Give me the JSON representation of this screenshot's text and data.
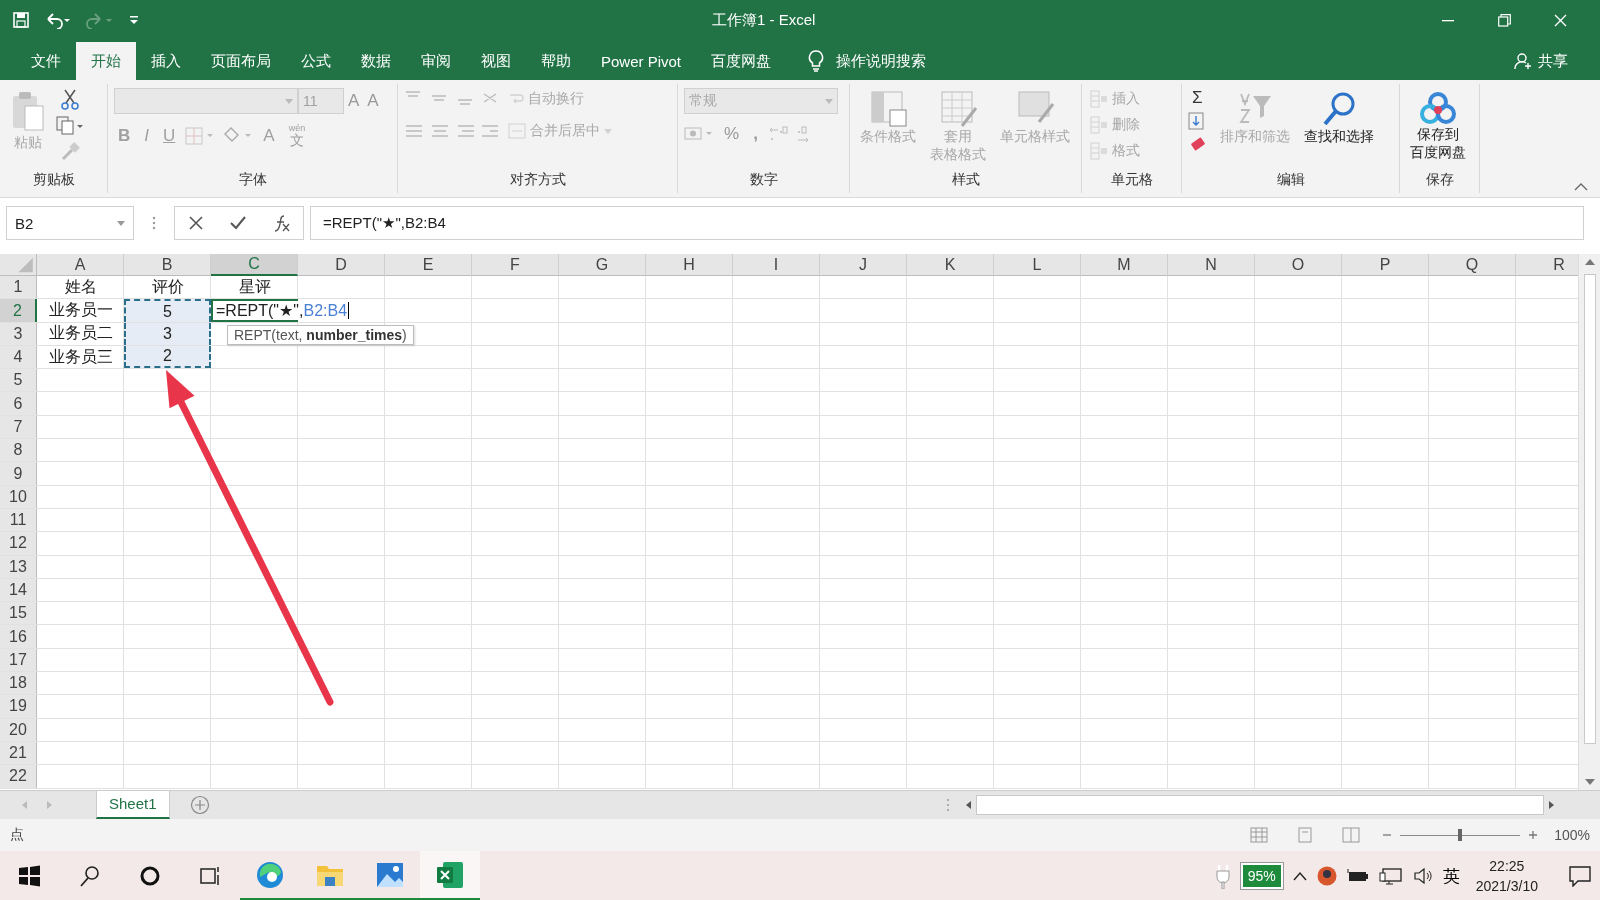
{
  "title_bar": {
    "title": "工作簿1  -  Excel"
  },
  "ribbon_tabs": [
    {
      "label": "文件",
      "selected": false
    },
    {
      "label": "开始",
      "selected": true
    },
    {
      "label": "插入",
      "selected": false
    },
    {
      "label": "页面布局",
      "selected": false
    },
    {
      "label": "公式",
      "selected": false
    },
    {
      "label": "数据",
      "selected": false
    },
    {
      "label": "审阅",
      "selected": false
    },
    {
      "label": "视图",
      "selected": false
    },
    {
      "label": "帮助",
      "selected": false
    },
    {
      "label": "Power Pivot",
      "selected": false
    },
    {
      "label": "百度网盘",
      "selected": false
    }
  ],
  "tell_me": "操作说明搜索",
  "share": "共享",
  "ribbon": {
    "clipboard": {
      "label": "剪贴板",
      "paste": {
        "label": "粘贴",
        "disabled": true
      }
    },
    "font": {
      "label": "字体",
      "font_size": "11",
      "grow": "A",
      "shrink": "A",
      "bold": "B",
      "italic": "I",
      "underline": "U",
      "font_color": "A",
      "phonetic_hint": "wén",
      "phonetic": "文",
      "disabled": true
    },
    "alignment": {
      "label": "对齐方式",
      "wrap": "自动换行",
      "merge": "合并后居中",
      "disabled": true
    },
    "number": {
      "label": "数字",
      "format": "常规",
      "percent": "%",
      "comma": ",",
      "disabled": true
    },
    "styles": {
      "label": "样式",
      "buttons": [
        {
          "label": "条件格式",
          "disabled": true
        },
        {
          "label": "套用",
          "label2": "表格格式",
          "disabled": true
        },
        {
          "label": "单元格样式",
          "disabled": true
        }
      ]
    },
    "cells": {
      "label": "单元格",
      "buttons": [
        {
          "label": "插入",
          "disabled": true
        },
        {
          "label": "删除",
          "disabled": true
        },
        {
          "label": "格式",
          "disabled": true
        }
      ]
    },
    "editing": {
      "label": "编辑",
      "sum": "Σ",
      "sort": {
        "label": "排序和筛选",
        "disabled": true
      },
      "find": {
        "label": "查找和选择",
        "disabled": false
      }
    },
    "save": {
      "label": "保存",
      "button": {
        "label": "保存到",
        "label2": "百度网盘",
        "disabled": false
      }
    }
  },
  "formula_bar": {
    "name_box": "B2",
    "formula": "=REPT(\"★\",B2:B4"
  },
  "columns": [
    {
      "label": "A",
      "selected": false
    },
    {
      "label": "B",
      "selected": false
    },
    {
      "label": "C",
      "selected": true
    },
    {
      "label": "D",
      "selected": false
    },
    {
      "label": "E",
      "selected": false
    },
    {
      "label": "F",
      "selected": false
    },
    {
      "label": "G",
      "selected": false
    },
    {
      "label": "H",
      "selected": false
    },
    {
      "label": "I",
      "selected": false
    },
    {
      "label": "J",
      "selected": false
    },
    {
      "label": "K",
      "selected": false
    },
    {
      "label": "L",
      "selected": false
    },
    {
      "label": "M",
      "selected": false
    },
    {
      "label": "N",
      "selected": false
    },
    {
      "label": "O",
      "selected": false
    },
    {
      "label": "P",
      "selected": false
    },
    {
      "label": "Q",
      "selected": false
    },
    {
      "label": "R",
      "selected": false
    }
  ],
  "rows": [
    {
      "header": "1",
      "selected": false,
      "cells": [
        {
          "text": "姓名",
          "highlighted": false
        },
        {
          "text": "评价",
          "highlighted": false
        },
        {
          "text": "星评",
          "highlighted": false
        }
      ]
    },
    {
      "header": "2",
      "selected": true,
      "cells": [
        {
          "text": "业务员一",
          "highlighted": false
        },
        {
          "text": "5",
          "highlighted": true
        },
        {
          "editing": {
            "text": "=REPT(\"★\",",
            "reference": "B2:B4"
          },
          "tooltip": "REPT(text, **number_times**)",
          "highlighted": false
        }
      ]
    },
    {
      "header": "3",
      "selected": false,
      "cells": [
        {
          "text": "业务员二",
          "highlighted": false
        },
        {
          "text": "3",
          "highlighted": true
        }
      ]
    },
    {
      "header": "4",
      "selected": false,
      "cells": [
        {
          "text": "业务员三",
          "highlighted": false
        },
        {
          "text": "2",
          "highlighted": true
        }
      ]
    },
    {
      "header": "5",
      "selected": false
    },
    {
      "header": "6",
      "selected": false
    },
    {
      "header": "7",
      "selected": false
    },
    {
      "header": "8",
      "selected": false
    },
    {
      "header": "9",
      "selected": false
    },
    {
      "header": "10",
      "selected": false
    },
    {
      "header": "11",
      "selected": false
    },
    {
      "header": "12",
      "selected": false
    },
    {
      "header": "13",
      "selected": false
    },
    {
      "header": "14",
      "selected": false
    },
    {
      "header": "15",
      "selected": false
    },
    {
      "header": "16",
      "selected": false
    },
    {
      "header": "17",
      "selected": false
    },
    {
      "header": "18",
      "selected": false
    },
    {
      "header": "19",
      "selected": false
    },
    {
      "header": "20",
      "selected": false
    },
    {
      "header": "21",
      "selected": false
    },
    {
      "header": "22",
      "selected": false
    }
  ],
  "sheet_tabs": [
    {
      "label": "Sheet1",
      "selected": true
    }
  ],
  "status_bar": {
    "mode": "点",
    "zoom": {
      "level": 0.5,
      "reading": "100%"
    }
  },
  "taskbar": {
    "apps": [
      {
        "kind": "edge",
        "running": true,
        "active": false
      },
      {
        "kind": "explorer",
        "running": true,
        "active": false
      },
      {
        "kind": "photos",
        "running": true,
        "active": false
      },
      {
        "kind": "excel",
        "running": true,
        "active": true
      }
    ],
    "battery": "95%",
    "ime": "英",
    "time": "22:25",
    "date": "2021/3/10"
  }
}
